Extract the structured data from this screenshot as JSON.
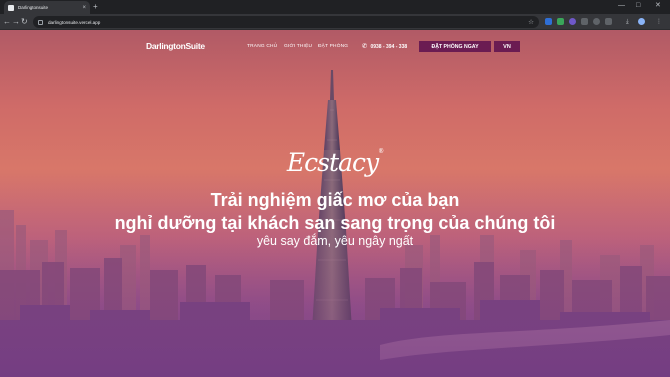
{
  "browser": {
    "tab_title": "Darlingtonsuite",
    "url": "darlingtonsuite.vercel.app",
    "new_tab_symbol": "+",
    "close_symbol": "×"
  },
  "site": {
    "logo": "DarlingtonSuite",
    "nav": [
      "TRANG CHỦ",
      "GIỚI THIỆU",
      "ĐẶT PHÒNG"
    ],
    "phone": "0938 - 394 - 338",
    "book_button": "ĐẶT PHÒNG NGAY",
    "lang_button": "VN"
  },
  "hero": {
    "brand": "Ecstacy",
    "brand_mark": "®",
    "headline_line1": "Trải nghiệm giấc mơ của bạn",
    "headline_line2": "nghỉ dưỡng tại khách sạn sang trọng của chúng tôi",
    "subline": "yêu say đắm, yêu ngây ngất"
  },
  "colors": {
    "button_bg": "#6b1c52",
    "sky_top": "#b15a66",
    "sky_mid": "#d87769",
    "ground": "#6d3d84"
  },
  "icons": [
    "site-info-icon",
    "star-icon",
    "phone-icon",
    "download-icon",
    "profile-icon",
    "menu-icon"
  ]
}
